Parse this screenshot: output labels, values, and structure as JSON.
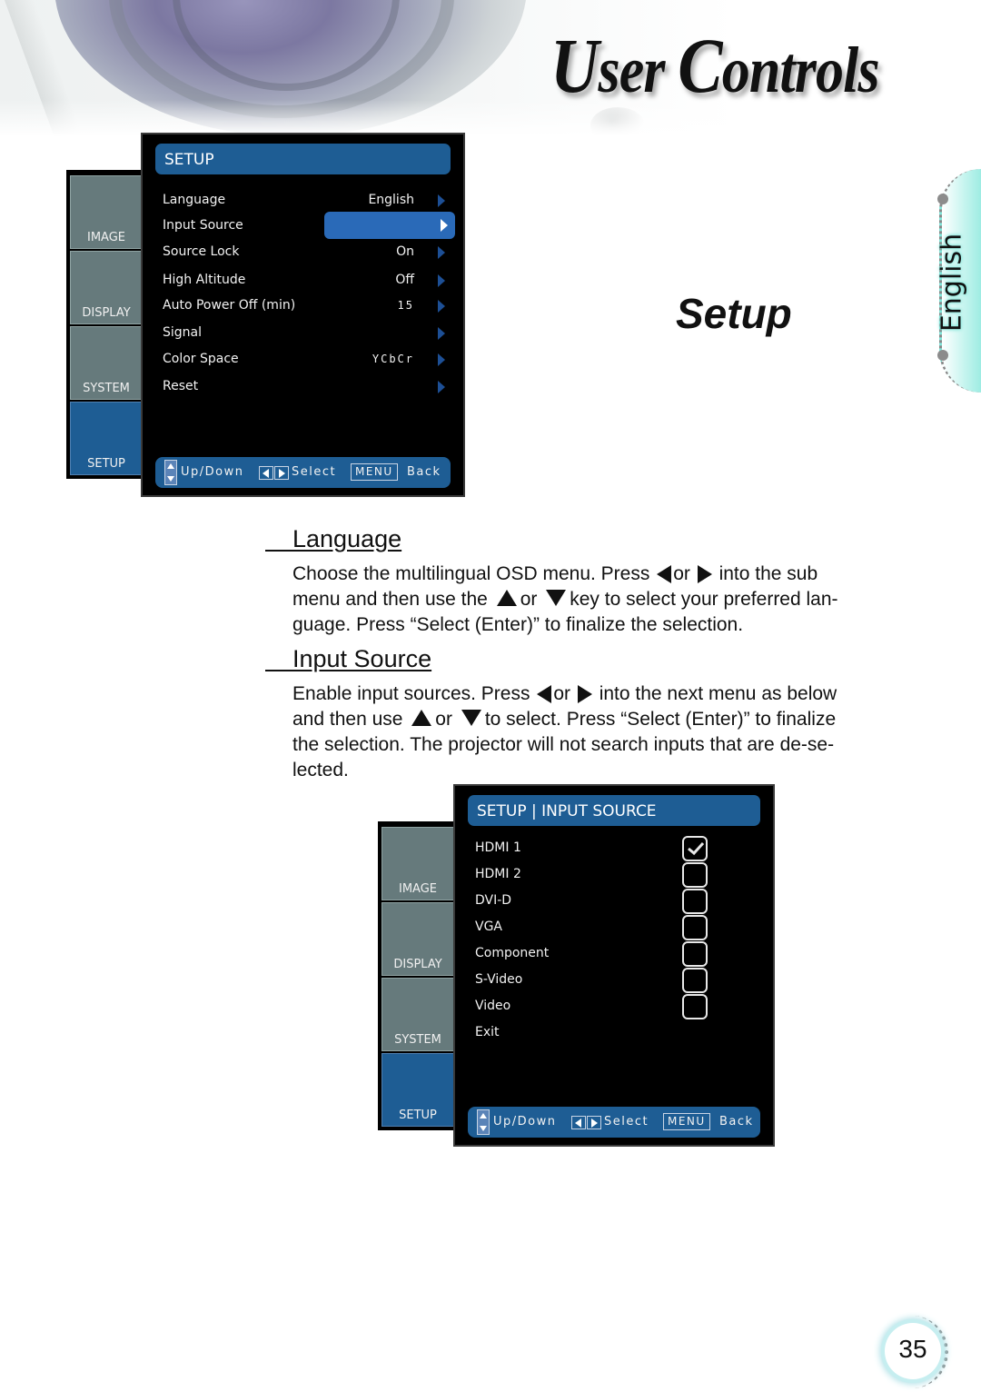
{
  "header": {
    "title": "User Controls",
    "title_cap_u": "U",
    "title_mid": "ser ",
    "title_cap_c": "C",
    "title_rest": "ontrols"
  },
  "side_tab": {
    "label": "English",
    "color": "#7fe6da"
  },
  "section_heading": "Setup",
  "osd_setup": {
    "tabs": [
      "IMAGE",
      "DISPLAY",
      "SYSTEM",
      "SETUP"
    ],
    "active_tab": "SETUP",
    "header": "SETUP",
    "items": [
      {
        "label": "Language",
        "value": "English"
      },
      {
        "label": "Input Source",
        "value": "",
        "highlighted": true
      },
      {
        "label": "Source Lock",
        "value": "On"
      },
      {
        "label": "High Altitude",
        "value": "Off"
      },
      {
        "label": "Auto Power Off (min)",
        "value": "15"
      },
      {
        "label": "Signal",
        "value": ""
      },
      {
        "label": "Color Space",
        "value": "YCbCr"
      },
      {
        "label": "Reset",
        "value": ""
      }
    ],
    "footer": {
      "updown": "Up/Down",
      "select": "Select",
      "menu_key": "MENU",
      "back": "Back"
    },
    "accent": "#1e5d94",
    "highlight": "#2a6ab8"
  },
  "language_section": {
    "title": "Language",
    "line1_a": "Choose the multilingual OSD menu. Press",
    "or": "or",
    "line1_b": "into the sub",
    "line2_a": "menu and then use the",
    "line2_b": "key to select your preferred lan-",
    "line3": "guage. Press “Select (Enter)” to finalize the selection."
  },
  "input_section": {
    "title": "Input Source",
    "line1_a": "Enable input sources. Press",
    "or": "or",
    "line1_b": "into the next menu as below",
    "line2_a": "and then use",
    "line2_b": "to select. Press “Select (Enter)” to finalize",
    "line3": "the selection. The projector will not search inputs that are de-se-",
    "line4": "lected."
  },
  "osd_input": {
    "tabs": [
      "IMAGE",
      "DISPLAY",
      "SYSTEM",
      "SETUP"
    ],
    "active_tab": "SETUP",
    "header": "SETUP | INPUT SOURCE",
    "items": [
      {
        "label": "HDMI 1",
        "checked": true
      },
      {
        "label": "HDMI 2",
        "checked": false
      },
      {
        "label": "DVI-D",
        "checked": false
      },
      {
        "label": "VGA",
        "checked": false
      },
      {
        "label": "Component",
        "checked": false
      },
      {
        "label": "S-Video",
        "checked": false
      },
      {
        "label": "Video",
        "checked": false
      },
      {
        "label": "Exit"
      }
    ],
    "footer": {
      "updown": "Up/Down",
      "select": "Select",
      "menu_key": "MENU",
      "back": "Back"
    }
  },
  "page_number": "35"
}
